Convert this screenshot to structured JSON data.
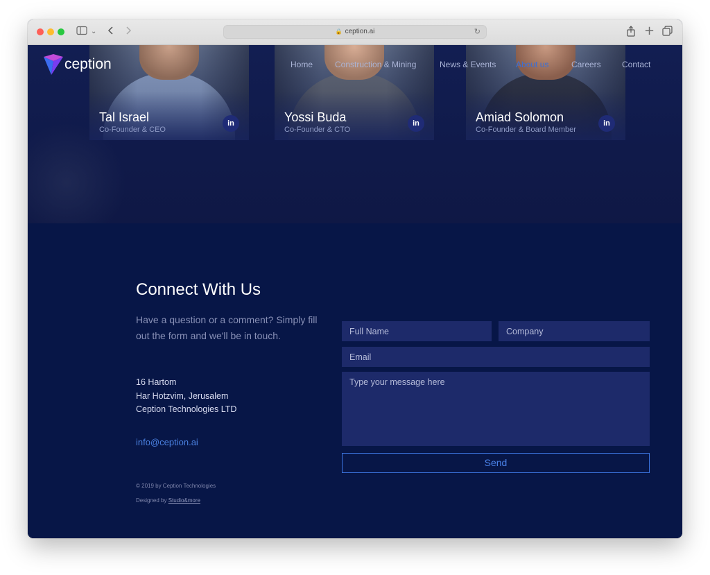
{
  "browser": {
    "url": "ception.ai"
  },
  "nav": {
    "logo_text": "ception",
    "links": [
      {
        "label": "Home"
      },
      {
        "label": "Construction & Mining"
      },
      {
        "label": "News & Events"
      },
      {
        "label": "About us",
        "active": true
      },
      {
        "label": "Careers"
      },
      {
        "label": "Contact"
      }
    ]
  },
  "team": [
    {
      "name": "Tal Israel",
      "role": "Co-Founder & CEO",
      "linkedin": "in"
    },
    {
      "name": "Yossi Buda",
      "role": "Co-Founder & CTO",
      "linkedin": "in"
    },
    {
      "name": "Amiad Solomon",
      "role": "Co-Founder & Board Member",
      "linkedin": "in"
    }
  ],
  "connect": {
    "title": "Connect With Us",
    "description": "Have a question or a comment? Simply fill out the form and we'll be in touch.",
    "address": [
      "16 Hartom",
      "Har Hotzvim, Jerusalem",
      "Ception Technologies LTD"
    ],
    "email": "info@ception.ai",
    "form": {
      "full_name_placeholder": "Full Name",
      "company_placeholder": "Company",
      "email_placeholder": "Email",
      "message_placeholder": "Type your message here",
      "send_label": "Send"
    },
    "footer": {
      "copyright": "© 2019 by Ception Technologies",
      "designed_by": "Designed by ",
      "studio": "Studio&more"
    }
  },
  "colors": {
    "background": "#071647",
    "field": "#1d2a6a",
    "accent": "#3b74e0",
    "active_nav": "#3a6fd8"
  }
}
